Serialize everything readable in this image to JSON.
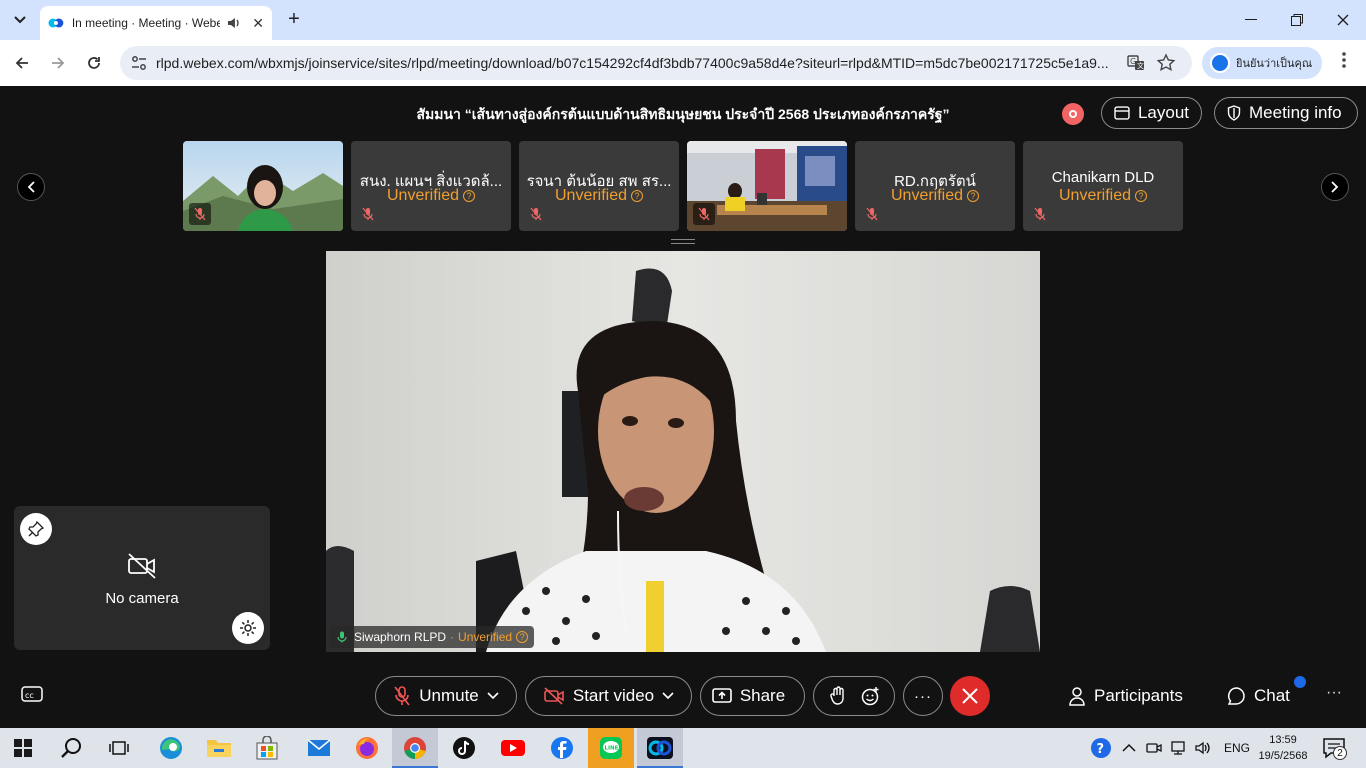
{
  "browser": {
    "tab_title": "In meeting · Meeting · Webex",
    "tab_close": "✕",
    "new_tab": "+",
    "url": "rlpd.webex.com/wbxmjs/joinservice/sites/rlpd/meeting/download/b07c154292cf4df3bdb77400c9a58d4e?siteurl=rlpd&MTID=m5dc7be002171725c5e1a9...",
    "profile_label": "ยินยันว่าเป็นคุณ",
    "window_controls": [
      "minimize",
      "restore",
      "close"
    ]
  },
  "meeting": {
    "title": "สัมมนา “เส้นทางสู่องค์กรต้นแบบด้านสิทธิมนุษยชน ประจำปี 2568 ประเภทองค์กรภาครัฐ”",
    "layout_label": "Layout",
    "meeting_info_label": "Meeting info",
    "participants_strip": [
      {
        "name": "",
        "status": "",
        "has_video": true
      },
      {
        "name": "สนง. แผนฯ สิ่งแวดล้...",
        "status": "Unverified",
        "has_video": false
      },
      {
        "name": "รจนา ต้นน้อย สพ สร...",
        "status": "Unverified",
        "has_video": false
      },
      {
        "name": "",
        "status": "",
        "has_video": true
      },
      {
        "name": "RD.กฤตรัตน์",
        "status": "Unverified",
        "has_video": false
      },
      {
        "name": "Chanikarn DLD",
        "status": "Unverified",
        "has_video": false
      }
    ],
    "active_speaker": {
      "name": "Siwaphorn RLPD",
      "separator": "·",
      "status": "Unverified"
    },
    "self_view": {
      "label": "No camera"
    },
    "controls": {
      "unmute": "Unmute",
      "start_video": "Start video",
      "share": "Share",
      "more": "···",
      "participants": "Participants",
      "chat": "Chat",
      "overflow": "···"
    }
  },
  "taskbar": {
    "clock_time": "13:59",
    "clock_date": "19/5/2568",
    "language": "ENG",
    "notification_count": "2",
    "apps": [
      "start",
      "search",
      "task-view",
      "edge",
      "file-explorer",
      "store",
      "mail",
      "firefox",
      "chrome",
      "tiktok",
      "youtube",
      "facebook",
      "line",
      "webex"
    ]
  },
  "colors": {
    "accent_unverified": "#f0a030",
    "leave_red": "#e02b2b",
    "chat_dot": "#1e6ae6",
    "app_bg": "#121212"
  }
}
